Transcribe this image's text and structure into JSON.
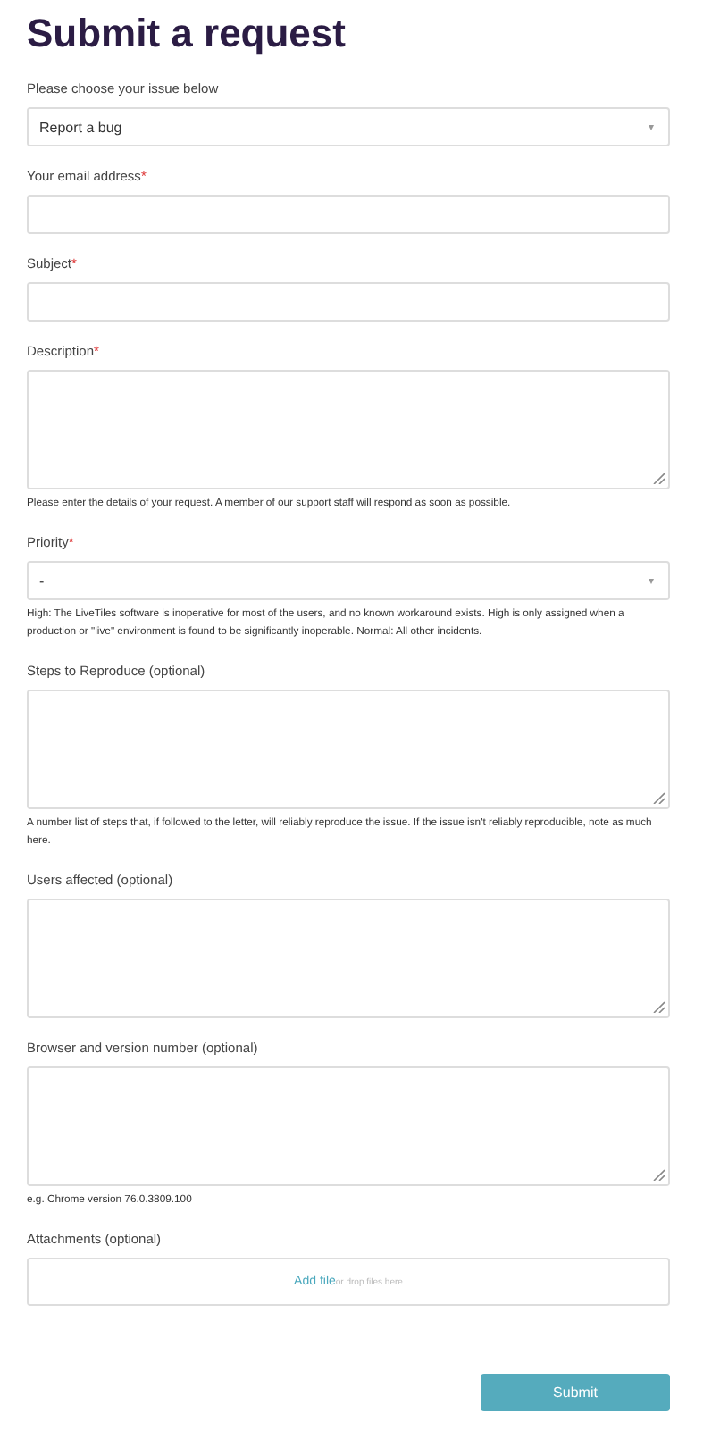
{
  "title": "Submit a request",
  "fields": [
    {
      "kind": "select",
      "label": "Please choose your issue below",
      "value": "Report a bug",
      "caret": "▾"
    },
    {
      "kind": "input",
      "label": "Your email address",
      "required_mark": "*"
    },
    {
      "kind": "input",
      "label": "Subject",
      "required_mark": "*"
    },
    {
      "kind": "textarea",
      "label": "Description",
      "required_mark": "*",
      "hint": "Please enter the details of your request. A member of our support staff will respond as soon as possible."
    },
    {
      "kind": "select",
      "label": "Priority",
      "required_mark": "*",
      "value": "-",
      "caret": "▾",
      "hint": "High: The LiveTiles software is inoperative for most of the users, and no known workaround exists. High is only assigned when a production or \"live\" environment is found to be significantly inoperable. Normal: All other incidents."
    },
    {
      "kind": "textarea",
      "label": "Steps to Reproduce (optional)",
      "hint": "A number list of steps that, if followed to the letter, will reliably reproduce the issue. If the issue isn't reliably reproducible, note as much here."
    },
    {
      "kind": "textarea",
      "label": "Users affected (optional)"
    },
    {
      "kind": "textarea",
      "label": "Browser and version number (optional)",
      "hint": "e.g. Chrome version 76.0.3809.100"
    },
    {
      "kind": "attachments",
      "label": "Attachments (optional)",
      "link": "Add file",
      "drop_text": "or drop files here"
    }
  ],
  "submit": "Submit"
}
